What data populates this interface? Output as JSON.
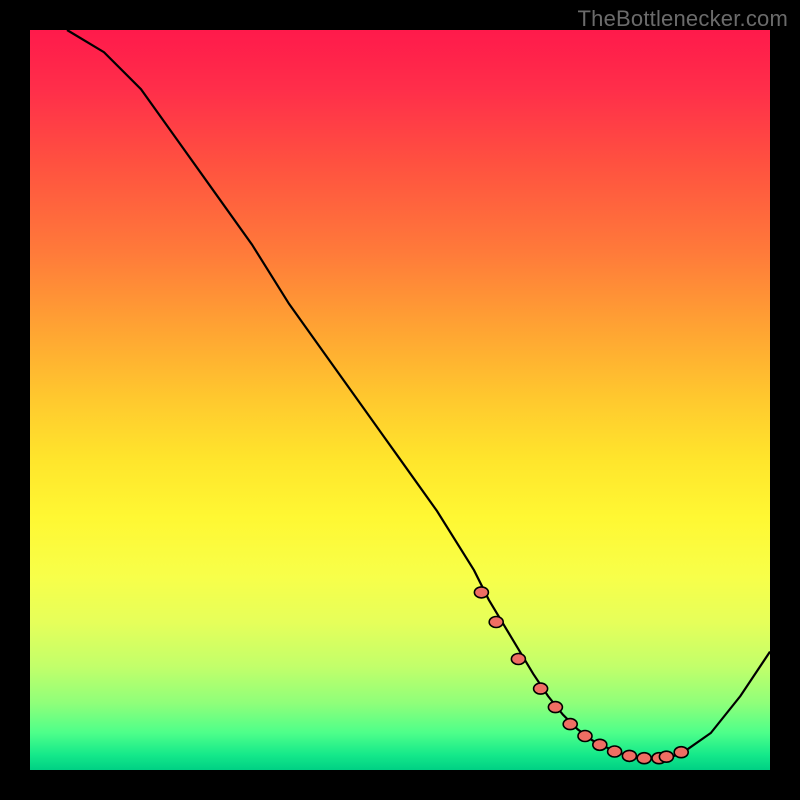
{
  "watermark": "TheBottlenecker.com",
  "chart_data": {
    "type": "line",
    "title": "",
    "xlabel": "",
    "ylabel": "",
    "xlim": [
      0,
      100
    ],
    "ylim": [
      0,
      100
    ],
    "series": [
      {
        "name": "curve",
        "x": [
          5,
          10,
          15,
          20,
          25,
          30,
          35,
          40,
          45,
          50,
          55,
          60,
          62,
          65,
          68,
          70,
          72,
          74,
          76,
          78,
          80,
          82,
          84,
          86,
          88,
          92,
          96,
          100
        ],
        "y": [
          100,
          97,
          92,
          85,
          78,
          71,
          63,
          56,
          49,
          42,
          35,
          27,
          23,
          18,
          13,
          10,
          7.5,
          5.5,
          4,
          3,
          2.2,
          1.7,
          1.5,
          1.6,
          2.2,
          5,
          10,
          16
        ]
      }
    ],
    "markers": {
      "name": "optimum-band",
      "x": [
        61,
        63,
        66,
        69,
        71,
        73,
        75,
        77,
        79,
        81,
        83,
        85,
        86,
        88
      ],
      "y": [
        24,
        20,
        15,
        11,
        8.5,
        6.2,
        4.6,
        3.4,
        2.5,
        1.9,
        1.6,
        1.6,
        1.8,
        2.4
      ]
    },
    "colors": {
      "curve": "#000000",
      "marker": "#ef6e63",
      "gradient_top": "#ff1a4b",
      "gradient_mid": "#ffe52c",
      "gradient_bottom": "#00d084"
    }
  }
}
